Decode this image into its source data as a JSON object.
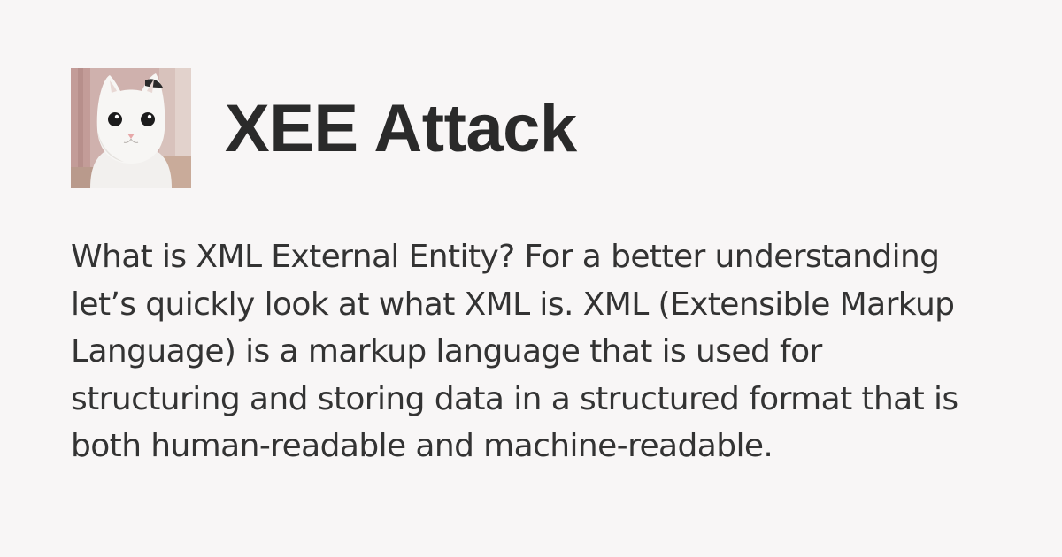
{
  "page": {
    "background": "#f8f6f6"
  },
  "avatar": {
    "icon": "white-cat-photo"
  },
  "title": "XEE Attack",
  "description": "What is XML External Entity? For a better understanding let’s quickly look at what XML is. XML (Extensible Markup Language) is a markup language that is used for structuring and storing data in a structured format that is both human-readable and machine-readable.",
  "colors": {
    "title": "#2a2a2a",
    "text": "#333333"
  }
}
